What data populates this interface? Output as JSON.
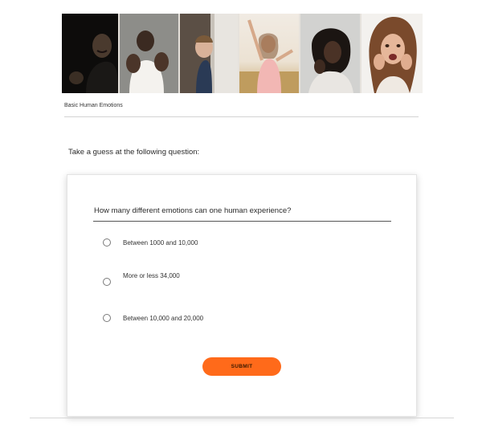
{
  "header": {
    "photos": [
      {
        "name": "angry-man-photo"
      },
      {
        "name": "fearful-man-photo"
      },
      {
        "name": "peeking-boy-photo"
      },
      {
        "name": "joyful-woman-photo"
      },
      {
        "name": "sad-woman-photo"
      },
      {
        "name": "surprised-woman-photo"
      }
    ],
    "caption": "Basic Human Emotions"
  },
  "main": {
    "prompt": "Take a guess at the following question:"
  },
  "quiz": {
    "question": "How many different emotions can one human experience?",
    "options": [
      {
        "label": "Between 1000 and 10,000",
        "selected": false
      },
      {
        "label": "More or less 34,000",
        "selected": false
      },
      {
        "label": "Between 10,000 and 20,000",
        "selected": false
      }
    ],
    "submit_label": "SUBMIT"
  },
  "colors": {
    "accent": "#ff6a1a",
    "card_border": "#e4e4e4",
    "rule": "#d3d3d3"
  }
}
